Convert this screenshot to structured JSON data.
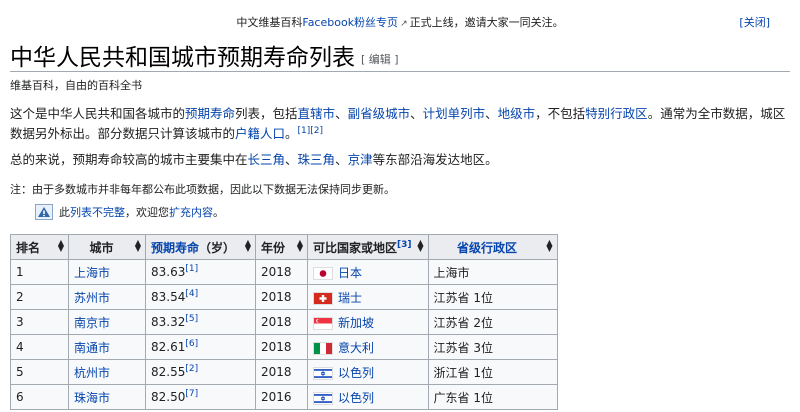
{
  "notice": {
    "before": "中文维基百科",
    "link": "Facebook粉丝专页",
    "after": "正式上线，邀请大家一同关注。",
    "close": "[关闭]"
  },
  "page": {
    "title": "中华人民共和国城市预期寿命列表",
    "edit": "[ 编辑 ]",
    "tagline": "维基百科，自由的百科全书"
  },
  "intro": {
    "t1": "这个是中华人民共和国各城市的",
    "l1": "预期寿命",
    "t2": "列表，包括",
    "l2": "直辖市",
    "t3": "、",
    "l3": "副省级城市",
    "t4": "、",
    "l4": "计划单列市",
    "t5": "、",
    "l5": "地级市",
    "t6": "，不包括",
    "l6": "特别行政区",
    "t7": "。通常为全市数据，城区数据另外标出。部分数据只计算该城市的",
    "l7": "户籍人口",
    "t8": "。",
    "ref": "[1][2]"
  },
  "summary": {
    "t1": "总的来说，预期寿命较高的城市主要集中在",
    "l1": "长三角",
    "t2": "、",
    "l2": "珠三角",
    "t3": "、",
    "l3": "京津",
    "t4": "等东部沿海发达地区。"
  },
  "note": "注：由于多数城市并非每年都公布此项数据，因此以下数据无法保持同步更新。",
  "stub": {
    "t1": "此",
    "l1": "列表不完整",
    "t2": "，欢迎您",
    "l2": "扩充内容",
    "t3": "。"
  },
  "table": {
    "headers": {
      "rank": "排名",
      "city": "城市",
      "life": "预期寿命",
      "life_unit": "（岁）",
      "year": "年份",
      "country": "可比国家或地区",
      "country_ref": "[3]",
      "province": "省级行政区"
    },
    "rows": [
      {
        "rank": "1",
        "city": "上海市",
        "life": "83.63",
        "ref": "[1]",
        "year": "2018",
        "flag": "japan",
        "country": "日本",
        "province": "上海市"
      },
      {
        "rank": "2",
        "city": "苏州市",
        "life": "83.54",
        "ref": "[4]",
        "year": "2018",
        "flag": "switzerland",
        "country": "瑞士",
        "province": "江苏省 1位"
      },
      {
        "rank": "3",
        "city": "南京市",
        "life": "83.32",
        "ref": "[5]",
        "year": "2018",
        "flag": "singapore",
        "country": "新加坡",
        "province": "江苏省 2位"
      },
      {
        "rank": "4",
        "city": "南通市",
        "life": "82.61",
        "ref": "[6]",
        "year": "2018",
        "flag": "italy",
        "country": "意大利",
        "province": "江苏省 3位"
      },
      {
        "rank": "5",
        "city": "杭州市",
        "life": "82.55",
        "ref": "[2]",
        "year": "2018",
        "flag": "israel",
        "country": "以色列",
        "province": "浙江省 1位"
      },
      {
        "rank": "6",
        "city": "珠海市",
        "life": "82.50",
        "ref": "[7]",
        "year": "2016",
        "flag": "israel",
        "country": "以色列",
        "province": "广东省 1位"
      }
    ]
  }
}
